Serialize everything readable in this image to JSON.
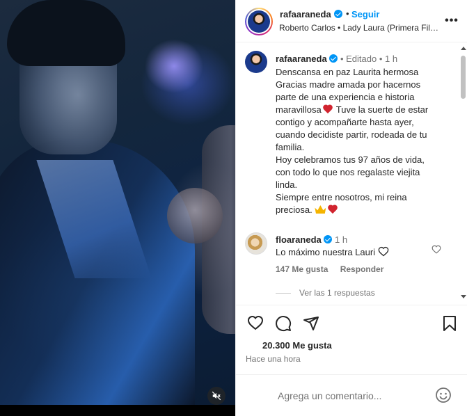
{
  "header": {
    "username": "rafaaraneda",
    "separator": "•",
    "follow_label": "Seguir",
    "audio": "Roberto Carlos • Lady Laura (Primera Fila...",
    "more_label": "•••"
  },
  "caption": {
    "username": "rafaaraneda",
    "meta": "• Editado • 1 h",
    "lines": [
      "Denscansa en paz Laurita hermosa",
      "Gracias madre amada por hacernos",
      "parte de una experiencia e historia",
      "maravillosa",
      "Tuve la suerte de estar",
      "contigo y acompañarte hasta ayer,",
      "cuando decidiste partir, rodeada de tu",
      "familia.",
      "Hoy celebramos tus 97 años de vida,",
      "con todo lo que nos regalaste viejita",
      "linda.",
      "Siempre entre nosotros, mi reina",
      "preciosa."
    ]
  },
  "comment": {
    "username": "floaraneda",
    "time": "1 h",
    "text": "Lo máximo nuestra Lauri",
    "likes": "147 Me gusta",
    "reply_label": "Responder",
    "view_replies": "Ver las 1 respuestas"
  },
  "post": {
    "likes": "20.300 Me gusta",
    "posted": "Hace una hora"
  },
  "composer": {
    "placeholder": "Agrega un comentario..."
  },
  "icons": {
    "verified": "verified-badge-icon",
    "like": "heart-outline-icon",
    "comment": "comment-bubble-icon",
    "share": "paper-plane-icon",
    "save": "bookmark-icon",
    "emoji": "smiley-icon",
    "mute": "speaker-muted-icon"
  },
  "colors": {
    "accent": "#0095f6",
    "muted_text": "#737373",
    "text": "#262626"
  }
}
